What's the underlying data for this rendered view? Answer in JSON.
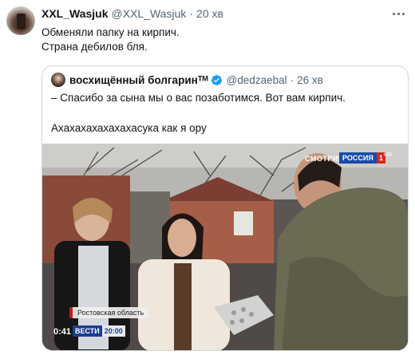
{
  "tweet": {
    "display_name": "XXL_Wasjuk",
    "handle": "@XXL_Wasjuk",
    "separator": "·",
    "time": "20 хв",
    "lines": [
      "Обменяли папку на кирпич.",
      "Страна дебилов бля."
    ]
  },
  "quote": {
    "display_name": "восхищённый болгаринᵀᴹ",
    "handle": "@dedzaebal",
    "separator": "·",
    "time": "26 хв",
    "line1": "– Спасибо за сына мы о вас позаботимся. Вот вам кирпич.",
    "line2": "Ахахахахахахахасука как я ору",
    "video": {
      "channel_logo": "СМОТРИМ",
      "network": "РОССИЯ",
      "network_number": "1",
      "hd": "HD",
      "region": "Ростовская область",
      "timestamp": "0:41",
      "program": "ВЕСТИ",
      "program_time": "20:00"
    }
  },
  "colors": {
    "text": "#0f1419",
    "secondary": "#536471",
    "border": "#cfd9de",
    "verified": "#1d9bf0"
  },
  "icons": [
    "more-icon",
    "verified-icon"
  ]
}
